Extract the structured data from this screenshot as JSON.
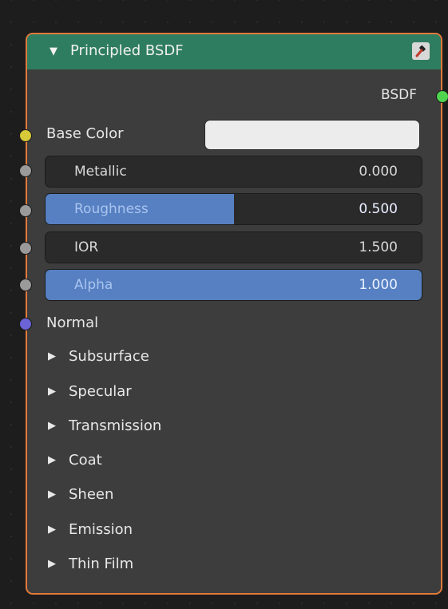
{
  "node": {
    "title": "Principled BSDF",
    "collapse_icon": "triangle-down-icon",
    "preview_icon": "hammer-icon",
    "output": {
      "label": "BSDF",
      "socket_color": "#4fd44f"
    },
    "base_color": {
      "label": "Base Color",
      "socket_color": "#d6c93a",
      "swatch_color": "#ececec"
    },
    "sliders": [
      {
        "name": "Metallic",
        "value": "0.000",
        "fraction": 0.0
      },
      {
        "name": "Roughness",
        "value": "0.500",
        "fraction": 0.5
      },
      {
        "name": "IOR",
        "value": "1.500",
        "fraction": 0.0
      },
      {
        "name": "Alpha",
        "value": "1.000",
        "fraction": 1.0
      }
    ],
    "normal": {
      "label": "Normal",
      "socket_color": "#6b63d6"
    },
    "panels": [
      "Subsurface",
      "Specular",
      "Transmission",
      "Coat",
      "Sheen",
      "Emission",
      "Thin Film"
    ]
  },
  "colors": {
    "header": "#2f7d60",
    "border": "#e0793a",
    "body": "#3d3d3d",
    "slider_bg": "#2a2a2a",
    "slider_fill": "#5680c2",
    "grey_socket": "#9a9a9a"
  }
}
